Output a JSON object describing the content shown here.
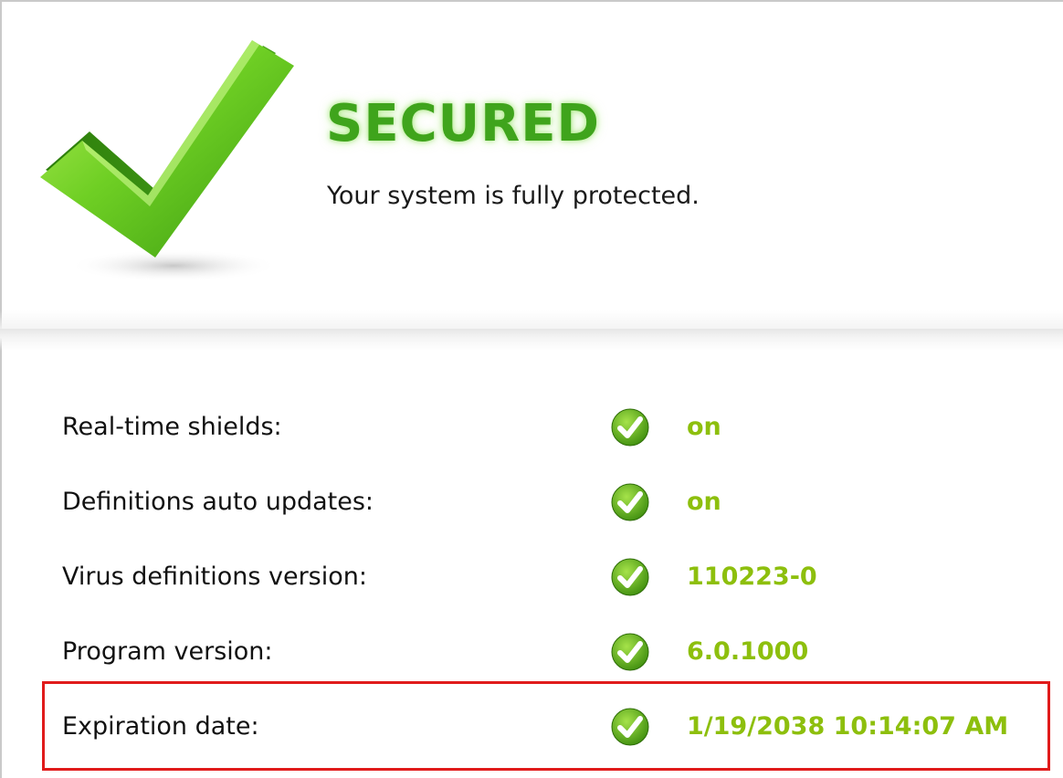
{
  "status": {
    "title": "SECURED",
    "subtitle": "Your system is fully protected.",
    "icon": "big-green-checkmark-icon",
    "accent_color": "#3fa41c"
  },
  "info_rows": [
    {
      "label": "Real-time shields:",
      "value": "on",
      "icon": "green-check-icon"
    },
    {
      "label": "Definitions auto updates:",
      "value": "on",
      "icon": "green-check-icon"
    },
    {
      "label": "Virus definitions version:",
      "value": "110223-0",
      "icon": "green-check-icon"
    },
    {
      "label": "Program version:",
      "value": "6.0.1000",
      "icon": "green-check-icon"
    },
    {
      "label": "Expiration date:",
      "value": "1/19/2038 10:14:07 AM",
      "icon": "green-check-icon",
      "highlighted": true
    }
  ],
  "colors": {
    "value_text": "#8dbf0d",
    "highlight_border": "#e01b1b"
  }
}
